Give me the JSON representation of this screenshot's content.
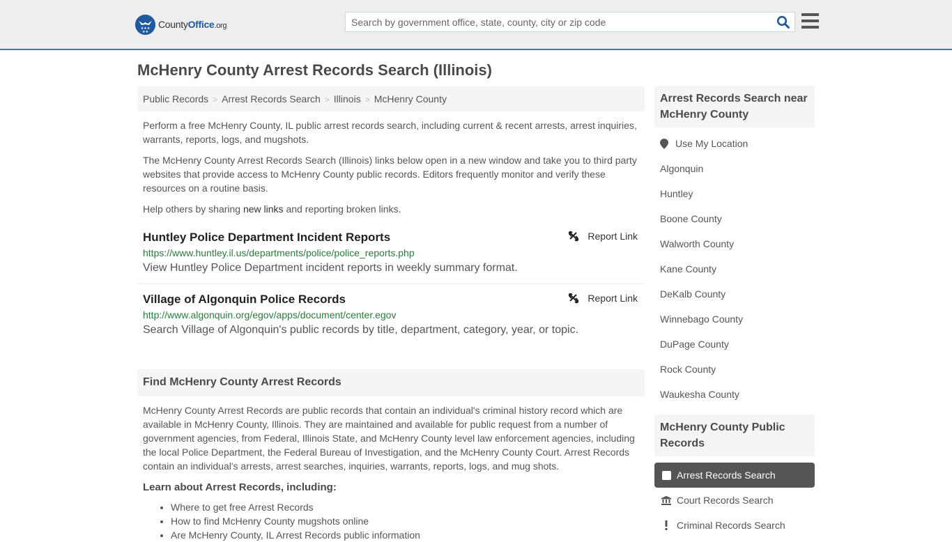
{
  "header": {
    "logo": {
      "name_prefix": "County",
      "name_brand": "Office",
      "name_suffix": ".org"
    },
    "search": {
      "placeholder": "Search by government office, state, county, city or zip code",
      "value": ""
    }
  },
  "page_title": "McHenry County Arrest Records Search (Illinois)",
  "breadcrumb": [
    "Public Records",
    "Arrest Records Search",
    "Illinois",
    "McHenry County"
  ],
  "intro": {
    "p1": "Perform a free McHenry County, IL public arrest records search, including current & recent arrests, arrest inquiries, warrants, reports, logs, and mugshots.",
    "p2": "The McHenry County Arrest Records Search (Illinois) links below open in a new window and take you to third party websites that provide access to McHenry County public records. Editors frequently monitor and verify these resources on a routine basis.",
    "p3_before": "Help others by sharing ",
    "p3_link": "new links",
    "p3_after": " and reporting broken links."
  },
  "records": [
    {
      "title": "Huntley Police Department Incident Reports",
      "url": "https://www.huntley.il.us/departments/police/police_reports.php",
      "description": "View Huntley Police Department incident reports in weekly summary format.",
      "report_label": "Report Link"
    },
    {
      "title": "Village of Algonquin Police Records",
      "url": "http://www.algonquin.org/egov/apps/document/center.egov",
      "description": "Search Village of Algonquin's public records by title, department, category, year, or topic.",
      "report_label": "Report Link"
    }
  ],
  "find_section": {
    "title": "Find McHenry County Arrest Records",
    "text": "McHenry County Arrest Records are public records that contain an individual's criminal history record which are available in McHenry County, Illinois. They are maintained and available for public request from a number of government agencies, from Federal, Illinois State, and McHenry County level law enforcement agencies, including the local Police Department, the Federal Bureau of Investigation, and the McHenry County Court. Arrest Records contain an individual's arrests, arrest searches, inquiries, warrants, reports, logs, and mug shots.",
    "learn_title": "Learn about Arrest Records, including:",
    "learn_items": [
      "Where to get free Arrest Records",
      "How to find McHenry County mugshots online",
      "Are McHenry County, IL Arrest Records public information"
    ]
  },
  "sidebar": {
    "nearby_title": "Arrest Records Search near McHenry County",
    "use_location": "Use My Location",
    "nearby": [
      "Algonquin",
      "Huntley",
      "Boone County",
      "Walworth County",
      "Kane County",
      "DeKalb County",
      "Winnebago County",
      "DuPage County",
      "Rock County",
      "Waukesha County"
    ],
    "public_records_title": "McHenry County Public Records",
    "public_records": [
      {
        "label": "Arrest Records Search",
        "icon": "square-icon",
        "active": true
      },
      {
        "label": "Court Records Search",
        "icon": "courthouse-icon",
        "active": false
      },
      {
        "label": "Criminal Records Search",
        "icon": "exclamation-icon",
        "active": false
      }
    ]
  }
}
